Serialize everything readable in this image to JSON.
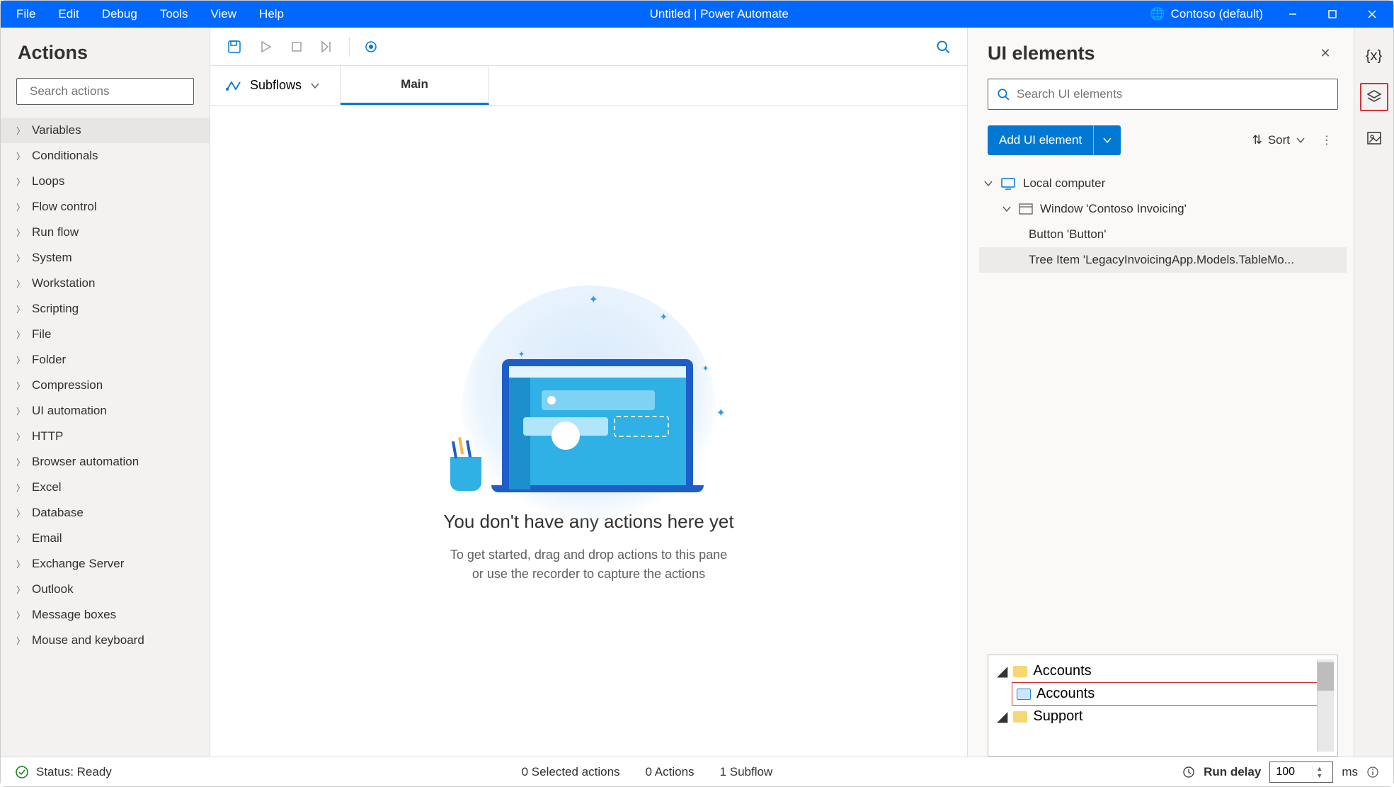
{
  "menu": [
    "File",
    "Edit",
    "Debug",
    "Tools",
    "View",
    "Help"
  ],
  "title": "Untitled | Power Automate",
  "account": "Contoso (default)",
  "actions": {
    "header": "Actions",
    "search_placeholder": "Search actions",
    "categories": [
      "Variables",
      "Conditionals",
      "Loops",
      "Flow control",
      "Run flow",
      "System",
      "Workstation",
      "Scripting",
      "File",
      "Folder",
      "Compression",
      "UI automation",
      "HTTP",
      "Browser automation",
      "Excel",
      "Database",
      "Email",
      "Exchange Server",
      "Outlook",
      "Message boxes",
      "Mouse and keyboard"
    ]
  },
  "tabs": {
    "subflows": "Subflows",
    "main": "Main"
  },
  "canvas": {
    "title": "You don't have any actions here yet",
    "sub1": "To get started, drag and drop actions to this pane",
    "sub2": "or use the recorder to capture the actions"
  },
  "ui": {
    "header": "UI elements",
    "search_placeholder": "Search UI elements",
    "add_label": "Add UI element",
    "sort": "Sort",
    "tree": {
      "root": "Local computer",
      "window": "Window 'Contoso Invoicing'",
      "item1": "Button 'Button'",
      "item2": "Tree Item 'LegacyInvoicingApp.Models.TableMo..."
    },
    "preview": {
      "r1": "Accounts",
      "r2": "Accounts",
      "r3": "Support"
    }
  },
  "status": {
    "ready": "Status: Ready",
    "selected": "0 Selected actions",
    "actions": "0 Actions",
    "subflow": "1 Subflow",
    "rundelay": "Run delay",
    "delay_value": "100",
    "ms": "ms"
  }
}
